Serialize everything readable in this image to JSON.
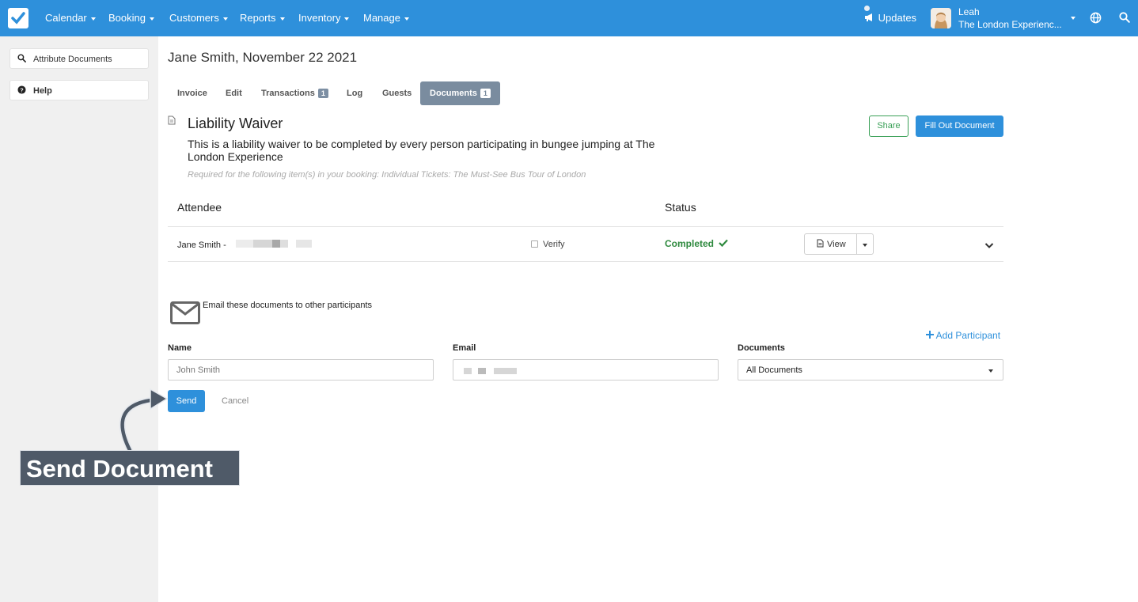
{
  "nav": {
    "items": [
      "Calendar",
      "Booking",
      "Customers",
      "Reports",
      "Inventory",
      "Manage"
    ],
    "updates": "Updates",
    "user_name": "Leah",
    "user_org": "The London Experienc..."
  },
  "sidebar": {
    "items": [
      {
        "label": "Attribute Documents",
        "icon": "search-icon"
      },
      {
        "label": "Help",
        "icon": "question-circle-icon"
      }
    ]
  },
  "page": {
    "title": "Jane Smith, November 22 2021"
  },
  "tabs": [
    {
      "label": "Invoice"
    },
    {
      "label": "Edit"
    },
    {
      "label": "Transactions",
      "badge": "1"
    },
    {
      "label": "Log"
    },
    {
      "label": "Guests"
    },
    {
      "label": "Documents",
      "badge": "1",
      "active": true
    }
  ],
  "document": {
    "title": "Liability Waiver",
    "description": "This is a liability waiver to be completed by every person participating in bungee jumping at The London Experience",
    "required": "Required for the following item(s) in your booking: Individual Tickets: The Must-See Bus Tour of London",
    "share_label": "Share",
    "fill_label": "Fill Out Document"
  },
  "table": {
    "headers": {
      "attendee": "Attendee",
      "status": "Status"
    },
    "rows": [
      {
        "attendee": "Jane Smith -",
        "verify": "Verify",
        "status": "Completed",
        "view": "View"
      }
    ]
  },
  "email": {
    "heading": "Email these documents to other participants",
    "add_participant": "Add Participant",
    "name_label": "Name",
    "name_placeholder": "John Smith",
    "email_label": "Email",
    "documents_label": "Documents",
    "documents_value": "All Documents",
    "send_label": "Send",
    "cancel_label": "Cancel"
  },
  "annotation": {
    "callout": "Send Document"
  },
  "colors": {
    "primary": "#2e90db",
    "active_tab": "#7a8c9f",
    "success": "#2f8a3f",
    "sidebar_bg": "#f0f0f0",
    "callout_bg": "#4f5a68"
  }
}
